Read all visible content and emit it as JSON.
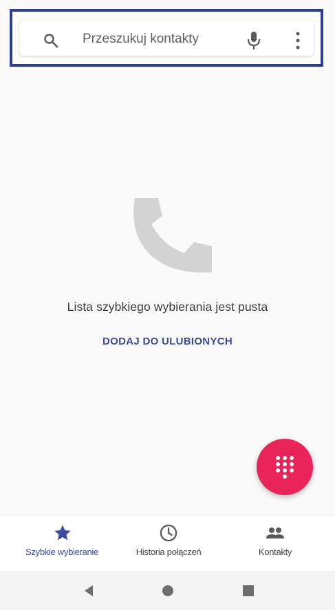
{
  "search": {
    "placeholder": "Przeszukuj kontakty",
    "icons": [
      "search-icon",
      "mic-icon",
      "more-vert-icon"
    ]
  },
  "empty_state": {
    "icon": "phone-icon",
    "message": "Lista szybkiego wybierania jest pusta",
    "action_label": "DODAJ DO ULUBIONYCH"
  },
  "fab": {
    "icon": "dialpad-icon",
    "color": "#e8245b"
  },
  "bottom_nav": {
    "tabs": [
      {
        "label": "Szybkie wybieranie",
        "icon": "star-icon",
        "active": true
      },
      {
        "label": "Historia połączeń",
        "icon": "clock-icon",
        "active": false
      },
      {
        "label": "Kontakty",
        "icon": "people-icon",
        "active": false
      }
    ]
  },
  "system_nav": {
    "buttons": [
      "back-icon",
      "home-icon",
      "recents-icon"
    ]
  },
  "colors": {
    "accent": "#3b4aa3",
    "highlight_frame": "#2c3e94",
    "fab": "#e8245b"
  }
}
